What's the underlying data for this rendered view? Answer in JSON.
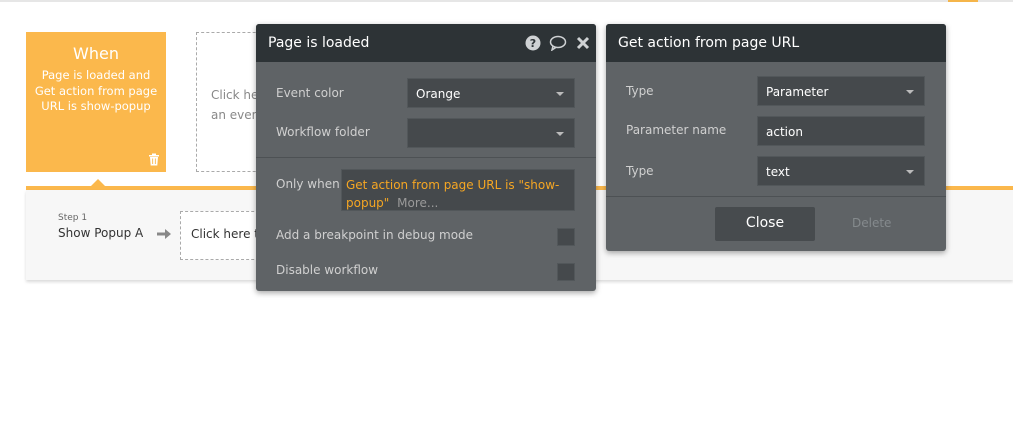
{
  "when_card": {
    "title": "When",
    "description": "Page is loaded and Get action from page URL is show-popup"
  },
  "event_placeholder": {
    "text": "Click here to add an event..."
  },
  "steps": [
    {
      "number": "Step 1",
      "name": "Show Popup A"
    }
  ],
  "action_placeholder": {
    "text": "Click here to add an action..."
  },
  "event_panel": {
    "title": "Page is loaded",
    "event_color_label": "Event color",
    "event_color_value": "Orange",
    "workflow_folder_label": "Workflow folder",
    "workflow_folder_value": "",
    "only_when_label": "Only when",
    "only_when_expression": "Get action from page URL is \"show-popup\"",
    "more_label": "More...",
    "breakpoint_label": "Add a breakpoint in debug mode",
    "disable_label": "Disable workflow",
    "colors": {
      "expression": "#f5a623",
      "header": "#2d3336",
      "body": "#5f6366"
    }
  },
  "url_panel": {
    "title": "Get action from page URL",
    "type_label": "Type",
    "type_value": "Parameter",
    "param_name_label": "Parameter name",
    "param_name_value": "action",
    "type2_label": "Type",
    "type2_value": "text",
    "close_label": "Close",
    "delete_label": "Delete"
  },
  "colors": {
    "accent": "#fbb84c"
  }
}
